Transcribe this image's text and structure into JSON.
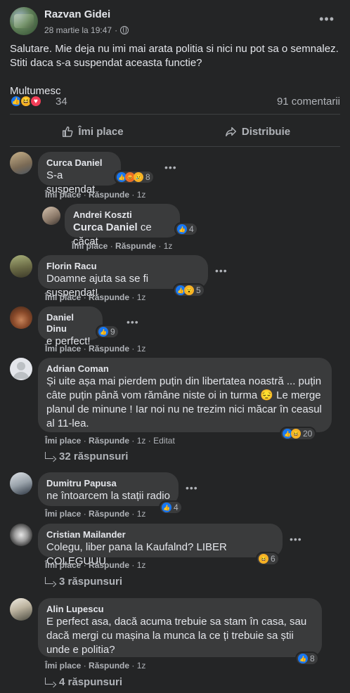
{
  "post": {
    "author": "Razvan Gidei",
    "timestamp": "28 martie la 19:47",
    "separator": "·",
    "text_p1": "Salutare. Mie deja nu imi mai arata politia si nici nu pot sa o semnalez. Stiti daca s-a suspendat aceasta functie?",
    "text_p2": "Multumesc",
    "reaction_count": "34",
    "comment_count": "91 comentarii",
    "actions": {
      "like": "Îmi place",
      "share": "Distribuie"
    }
  },
  "comment_meta": {
    "like": "Îmi place",
    "reply": "Răspunde",
    "sep": "·"
  },
  "comments": [
    {
      "name": "Curca Daniel",
      "text": "S-a suspendat",
      "reacts": "8",
      "time": "1z"
    },
    {
      "name": "Andrei Koszti",
      "mention": "Curca Daniel",
      "text": " ce căcat",
      "reacts": "4",
      "time": "1z"
    },
    {
      "name": "Florin Racu",
      "text": "Doamne ajuta sa se fi suspendat!",
      "reacts": "5",
      "time": "1z"
    },
    {
      "name": "Daniel Dinu",
      "text": "e perfect!",
      "reacts": "9",
      "time": "1z"
    },
    {
      "name": "Adrian Coman",
      "text": "Și uite așa mai pierdem puțin din libertatea noastră ... puțin câte puțin până vom rămâne niste oi in turma 😔 Le merge planul de minune ! Iar noi nu ne trezim nici măcar în ceasul al 11-lea.",
      "reacts": "20",
      "time": "1z",
      "edited": "Editat",
      "replies": "32 răspunsuri"
    },
    {
      "name": "Dumitru Papusa",
      "text": "ne întoarcem la stații radio",
      "reacts": "4",
      "time": "1z"
    },
    {
      "name": "Cristian Mailander",
      "text": "Colegu, liber pana la Kaufalnd? LIBER COLEGUUU",
      "reacts": "6",
      "time": "1z",
      "replies": "3 răspunsuri"
    },
    {
      "name": "Alin Lupescu",
      "text": "E perfect asa, dacă acuma trebuie sa stam în casa, sau dacă mergi cu mașina la munca la ce ți trebuie sa știi unde e politia?",
      "reacts": "8",
      "time": "1z",
      "replies": "4 răspunsuri"
    }
  ]
}
